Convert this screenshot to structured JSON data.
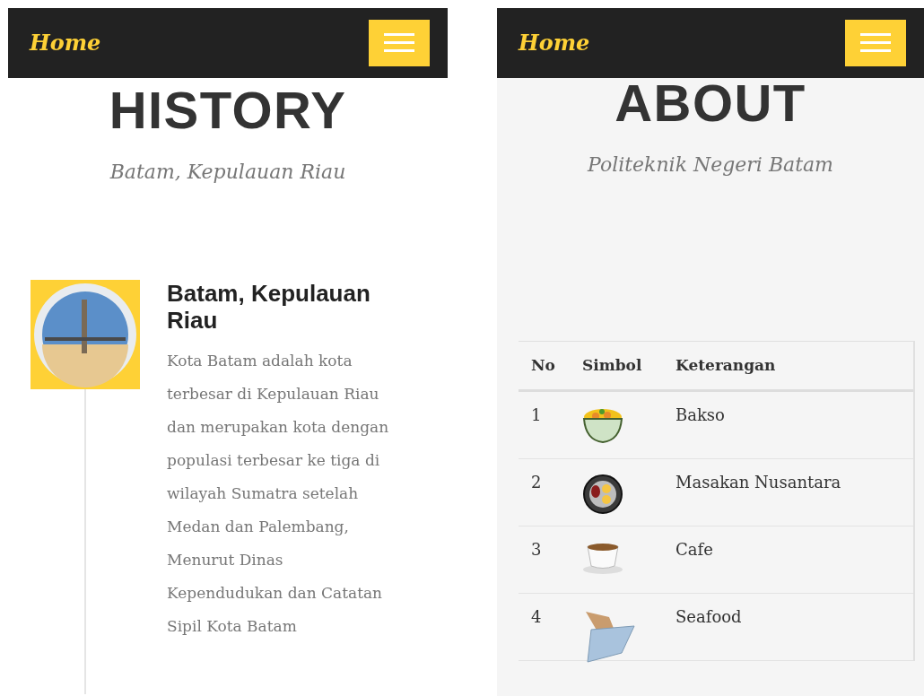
{
  "panels": [
    {
      "kind": "history",
      "navbar": {
        "brand": "Home"
      },
      "title": "HISTORY",
      "subtitle": "Batam, Kepulauan Riau",
      "timeline": [
        {
          "heading": "Batam, Kepulauan Riau",
          "body": "Kota Batam adalah kota terbesar di Kepulauan Riau dan merupakan kota dengan populasi terbesar ke tiga di wilayah Sumatra setelah Medan dan Palembang, Menurut Dinas Kependudukan dan Catatan Sipil Kota Batam"
        }
      ]
    },
    {
      "kind": "about",
      "navbar": {
        "brand": "Home"
      },
      "title": "ABOUT",
      "subtitle": "Politeknik Negeri Batam",
      "table": {
        "columns": [
          "No",
          "Simbol",
          "Keterangan"
        ],
        "rows": [
          {
            "no": "1",
            "kind": "bowl",
            "label": "Bakso"
          },
          {
            "no": "2",
            "kind": "plate",
            "label": "Masakan Nusantara"
          },
          {
            "no": "3",
            "kind": "cup",
            "label": "Cafe"
          },
          {
            "no": "4",
            "kind": "parcel",
            "label": "Seafood"
          }
        ]
      }
    }
  ]
}
